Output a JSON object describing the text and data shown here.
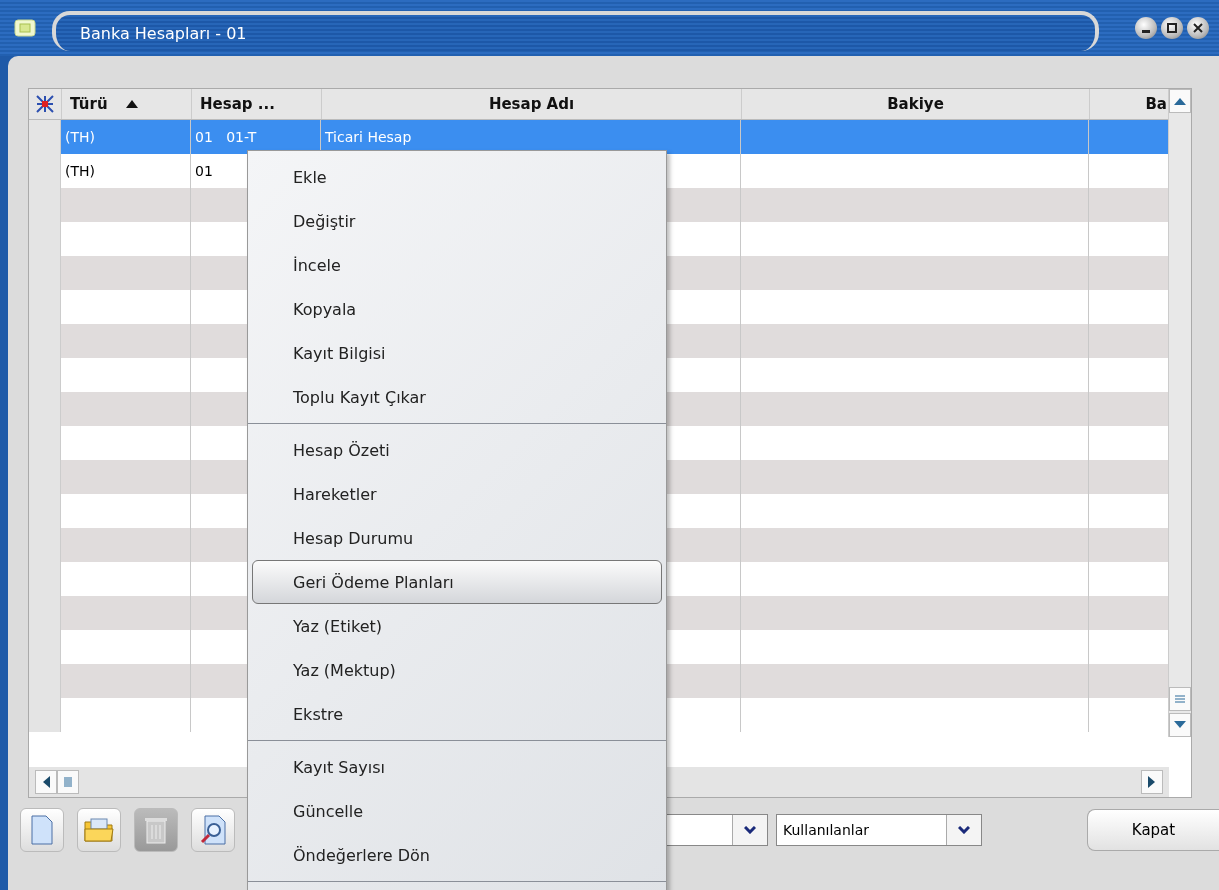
{
  "window": {
    "title": "Banka Hesapları - 01"
  },
  "table": {
    "columns": [
      {
        "label": "Türü",
        "sorted": true
      },
      {
        "label": "Hesap ...",
        "sorted": false
      },
      {
        "label": "Hesap Adı",
        "sorted": false
      },
      {
        "label": "Bakiye",
        "sorted": false
      },
      {
        "label": "Ba",
        "sorted": false
      }
    ],
    "rows": [
      {
        "selected": true,
        "cells": [
          "(TH)",
          "01   01-T",
          "Ticari Hesap"
        ]
      },
      {
        "selected": false,
        "cells": [
          "(TH)",
          "01"
        ]
      },
      {
        "selected": false
      },
      {
        "selected": false
      },
      {
        "selected": false
      },
      {
        "selected": false
      },
      {
        "selected": false
      },
      {
        "selected": false
      },
      {
        "selected": false
      },
      {
        "selected": false
      },
      {
        "selected": false
      },
      {
        "selected": false
      },
      {
        "selected": false
      },
      {
        "selected": false
      },
      {
        "selected": false
      },
      {
        "selected": false
      },
      {
        "selected": false
      },
      {
        "selected": false
      }
    ]
  },
  "toolbar": [
    {
      "kind": "new",
      "disabled": false
    },
    {
      "kind": "open",
      "disabled": false
    },
    {
      "kind": "delete",
      "disabled": true
    },
    {
      "kind": "preview",
      "disabled": false
    }
  ],
  "filters": [
    {
      "kind": "dropdown"
    },
    {
      "kind": "dropdown",
      "value": "Kullanılanlar"
    }
  ],
  "close_button": "Kapat",
  "context_menu": {
    "groups": [
      [
        {
          "label": "Ekle",
          "selected": false
        },
        {
          "label": "Değiştir",
          "selected": false
        },
        {
          "label": "İncele",
          "selected": false
        },
        {
          "label": "Kopyala",
          "selected": false
        },
        {
          "label": "Kayıt Bilgisi",
          "selected": false
        },
        {
          "label": "Toplu Kayıt Çıkar",
          "selected": false
        }
      ],
      [
        {
          "label": "Hesap Özeti",
          "selected": false
        },
        {
          "label": "Hareketler",
          "selected": false
        },
        {
          "label": "Hesap Durumu",
          "selected": false
        },
        {
          "label": "Geri Ödeme Planları",
          "selected": true
        },
        {
          "label": "Yaz (Etiket)",
          "selected": false
        },
        {
          "label": "Yaz (Mektup)",
          "selected": false
        },
        {
          "label": "Ekstre",
          "selected": false
        }
      ],
      [
        {
          "label": "Kayıt Sayısı",
          "selected": false
        },
        {
          "label": "Güncelle",
          "selected": false
        },
        {
          "label": "Öndeğerlere Dön",
          "selected": false
        }
      ]
    ]
  }
}
